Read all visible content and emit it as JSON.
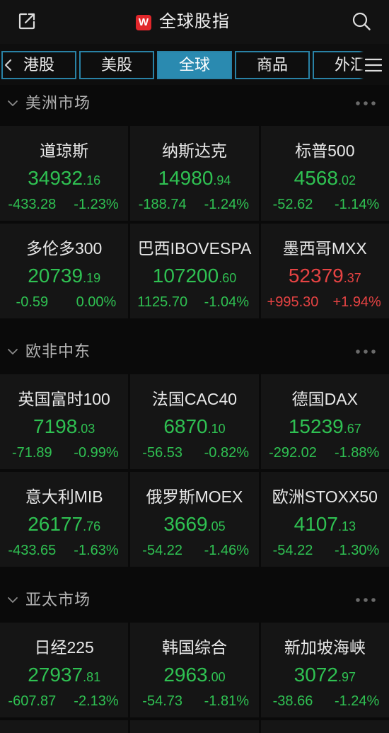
{
  "header": {
    "title": "全球股指",
    "logo_letter": "W",
    "logo_color": "#e2272b",
    "icons": [
      "share-icon",
      "search-icon"
    ]
  },
  "tabs": [
    {
      "label": "港股",
      "active": false
    },
    {
      "label": "美股",
      "active": false
    },
    {
      "label": "全球",
      "active": true
    },
    {
      "label": "商品",
      "active": false
    },
    {
      "label": "外汇",
      "active": false
    }
  ],
  "tab_icons": [
    "chevron-left-icon",
    "hamburger-menu-icon"
  ],
  "colors": {
    "down": "#2fc152",
    "up": "#e64343",
    "tab_border": "#2982a6",
    "tab_active_bg": "#2a8ab0"
  },
  "section_icons": [
    "chevron-down-icon",
    "more-dots-icon"
  ],
  "sections": [
    {
      "title": "美洲市场",
      "cards": [
        {
          "name": "道琼斯",
          "price_int": "34932",
          "price_dec": ".16",
          "change": "-433.28",
          "pct": "-1.23%",
          "color": "#2fc152"
        },
        {
          "name": "纳斯达克",
          "price_int": "14980",
          "price_dec": ".94",
          "change": "-188.74",
          "pct": "-1.24%",
          "color": "#2fc152"
        },
        {
          "name": "标普500",
          "price_int": "4568",
          "price_dec": ".02",
          "change": "-52.62",
          "pct": "-1.14%",
          "color": "#2fc152"
        },
        {
          "name": "多伦多300",
          "price_int": "20739",
          "price_dec": ".19",
          "change": "-0.59",
          "pct": "0.00%",
          "color": "#2fc152"
        },
        {
          "name": "巴西IBOVESPA",
          "price_int": "107200",
          "price_dec": ".60",
          "change": "1125.70",
          "pct": "-1.04%",
          "color": "#2fc152"
        },
        {
          "name": "墨西哥MXX",
          "price_int": "52379",
          "price_dec": ".37",
          "change": "+995.30",
          "pct": "+1.94%",
          "color": "#e64343"
        }
      ]
    },
    {
      "title": "欧非中东",
      "cards": [
        {
          "name": "英国富时100",
          "price_int": "7198",
          "price_dec": ".03",
          "change": "-71.89",
          "pct": "-0.99%",
          "color": "#2fc152"
        },
        {
          "name": "法国CAC40",
          "price_int": "6870",
          "price_dec": ".10",
          "change": "-56.53",
          "pct": "-0.82%",
          "color": "#2fc152"
        },
        {
          "name": "德国DAX",
          "price_int": "15239",
          "price_dec": ".67",
          "change": "-292.02",
          "pct": "-1.88%",
          "color": "#2fc152"
        },
        {
          "name": "意大利MIB",
          "price_int": "26177",
          "price_dec": ".76",
          "change": "-433.65",
          "pct": "-1.63%",
          "color": "#2fc152"
        },
        {
          "name": "俄罗斯MOEX",
          "price_int": "3669",
          "price_dec": ".05",
          "change": "-54.22",
          "pct": "-1.46%",
          "color": "#2fc152"
        },
        {
          "name": "欧洲STOXX50",
          "price_int": "4107",
          "price_dec": ".13",
          "change": "-54.22",
          "pct": "-1.30%",
          "color": "#2fc152"
        }
      ]
    },
    {
      "title": "亚太市场",
      "cards": [
        {
          "name": "日经225",
          "price_int": "27937",
          "price_dec": ".81",
          "change": "-607.87",
          "pct": "-2.13%",
          "color": "#2fc152"
        },
        {
          "name": "韩国综合",
          "price_int": "2963",
          "price_dec": ".00",
          "change": "-54.73",
          "pct": "-1.81%",
          "color": "#2fc152"
        },
        {
          "name": "新加坡海峡",
          "price_int": "3072",
          "price_dec": ".97",
          "change": "-38.66",
          "pct": "-1.24%",
          "color": "#2fc152"
        }
      ]
    }
  ]
}
